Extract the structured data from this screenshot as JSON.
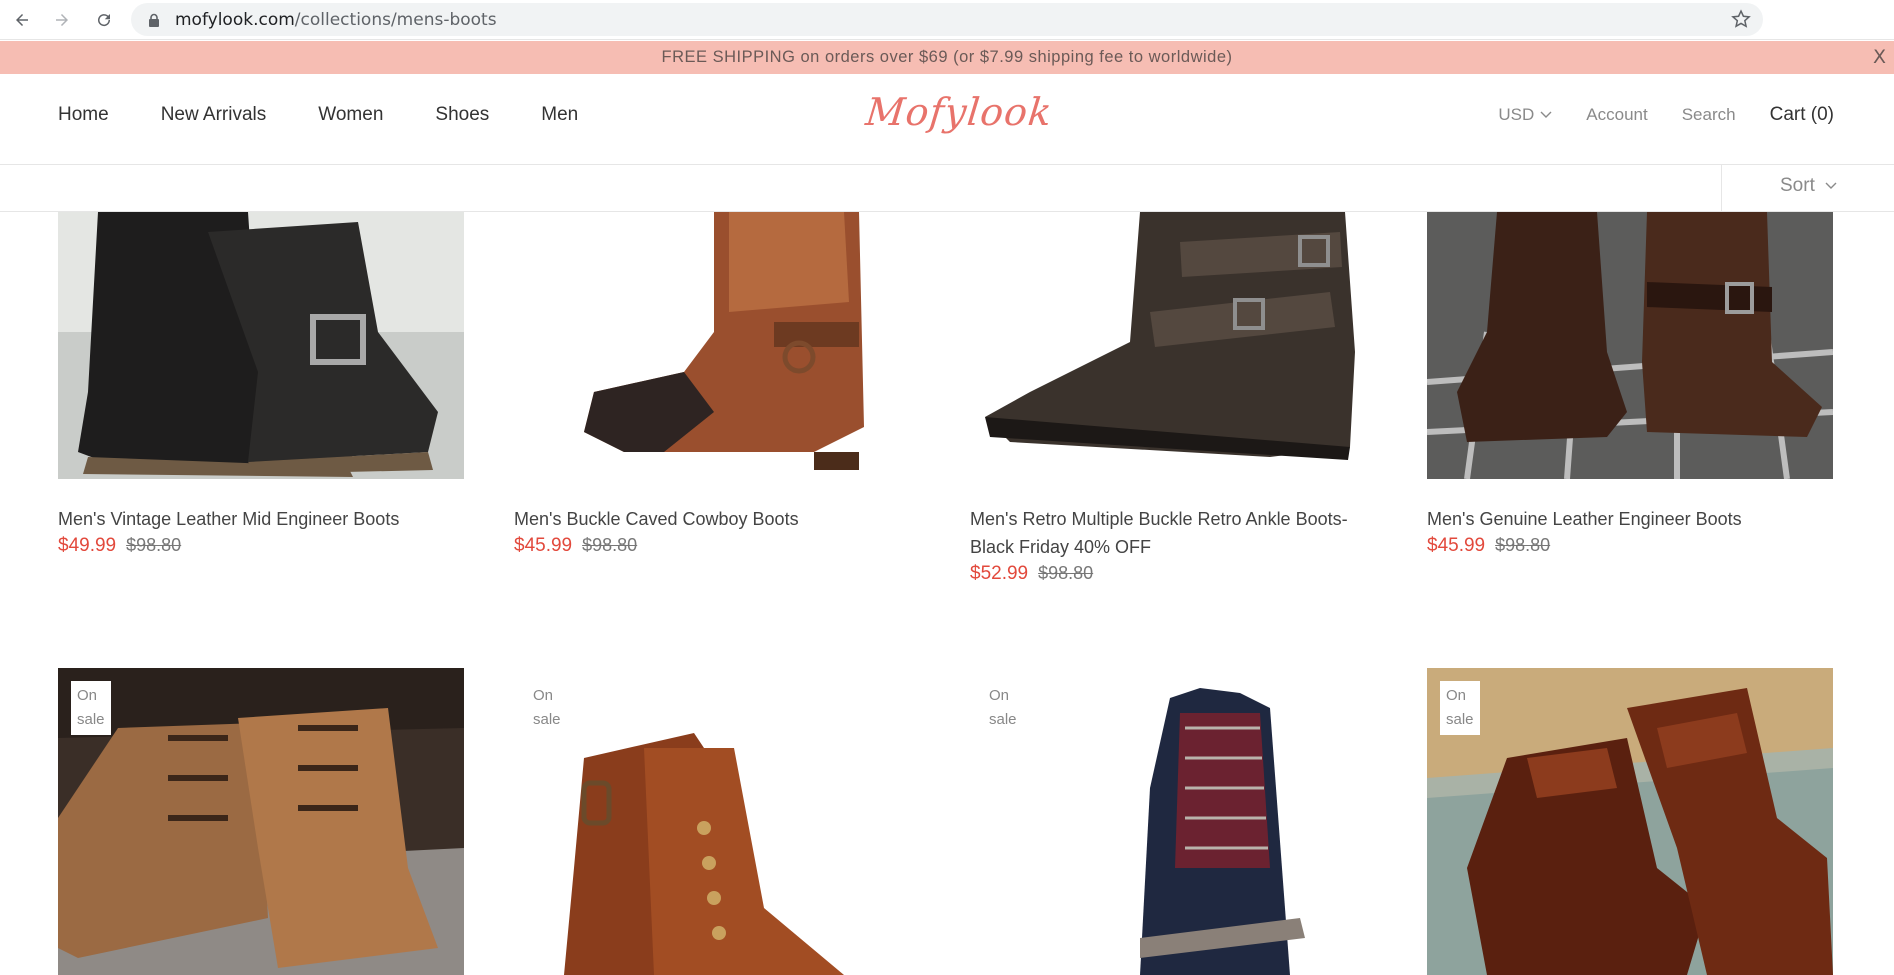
{
  "browser": {
    "url_domain": "mofylook.com",
    "url_path": "/collections/mens-boots"
  },
  "announcement": {
    "text": "FREE SHIPPING on orders over $69 (or $7.99 shipping fee to worldwide)",
    "close": "X"
  },
  "header": {
    "nav": [
      "Home",
      "New Arrivals",
      "Women",
      "Shoes",
      "Men"
    ],
    "logo": "Mofylook",
    "currency": "USD",
    "account": "Account",
    "search": "Search",
    "cart": "Cart (0)"
  },
  "sort": {
    "label": "Sort"
  },
  "products_row1": [
    {
      "title": "Men's Vintage Leather Mid Engineer Boots",
      "price": "$49.99",
      "compare": "$98.80"
    },
    {
      "title": "Men's Buckle Caved Cowboy Boots",
      "price": "$45.99",
      "compare": "$98.80"
    },
    {
      "title": "Men's Retro Multiple Buckle Retro Ankle Boots-Black Friday 40% OFF",
      "price": "$52.99",
      "compare": "$98.80"
    },
    {
      "title": "Men's Genuine Leather Engineer Boots",
      "price": "$45.99",
      "compare": "$98.80"
    }
  ],
  "products_row2": [
    {
      "badge": "On sale"
    },
    {
      "badge": "On sale"
    },
    {
      "badge": "On sale"
    },
    {
      "badge": "On sale"
    }
  ],
  "colors": {
    "accent": "#e2493c",
    "announce_bg": "#f6bdb3",
    "logo": "#e8736b"
  }
}
